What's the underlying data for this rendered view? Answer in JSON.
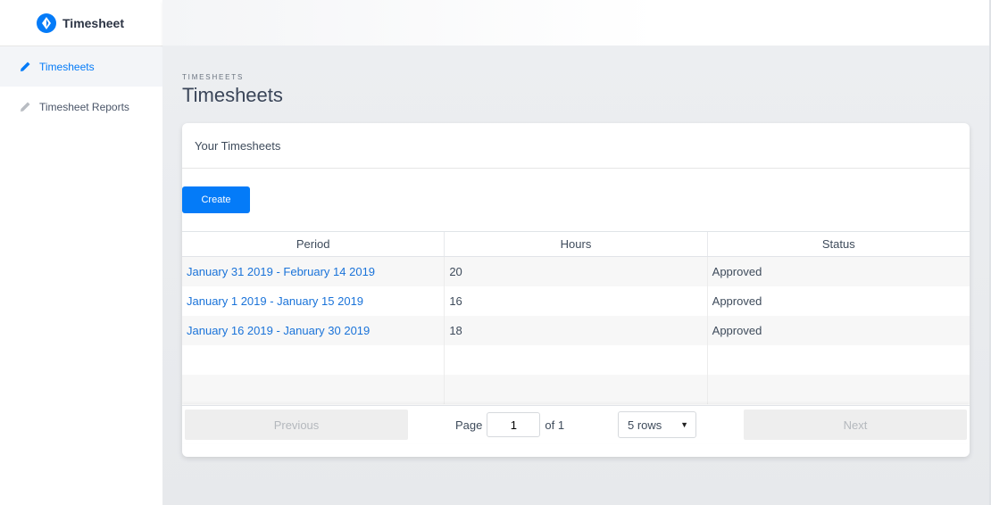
{
  "app": {
    "name": "Timesheet"
  },
  "sidebar": {
    "items": [
      {
        "label": "Timesheets",
        "active": true,
        "icon": "pencil-icon"
      },
      {
        "label": "Timesheet Reports",
        "active": false,
        "icon": "pencil-icon"
      }
    ]
  },
  "page": {
    "eyebrow": "TIMESHEETS",
    "title": "Timesheets"
  },
  "card": {
    "title": "Your Timesheets",
    "create_label": "Create"
  },
  "table": {
    "columns": [
      "Period",
      "Hours",
      "Status"
    ],
    "rows": [
      {
        "period": "January 31 2019 - February 14 2019",
        "hours": "20",
        "status": "Approved"
      },
      {
        "period": "January 1 2019 - January 15 2019",
        "hours": "16",
        "status": "Approved"
      },
      {
        "period": "January 16 2019 - January 30 2019",
        "hours": "18",
        "status": "Approved"
      }
    ]
  },
  "pagination": {
    "previous_label": "Previous",
    "next_label": "Next",
    "page_label": "Page",
    "page_value": "1",
    "of_label": "of 1",
    "rows_label": "5 rows"
  },
  "colors": {
    "accent": "#047bf8",
    "link": "#1a73d9"
  }
}
